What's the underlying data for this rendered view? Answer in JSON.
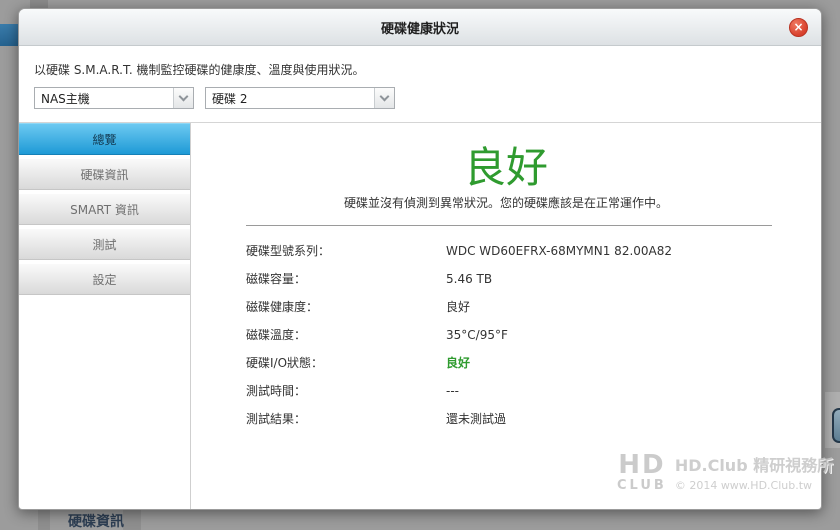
{
  "dialog": {
    "title": "硬碟健康狀況",
    "close_glyph": "×",
    "description": "以硬碟 S.M.A.R.T. 機制監控硬碟的健康度、溫度與使用狀況。",
    "selectors": {
      "host": {
        "value": "NAS主機"
      },
      "disk": {
        "value": "硬碟 2"
      }
    },
    "tabs": [
      {
        "label": "總覽",
        "active": true
      },
      {
        "label": "硬碟資訊",
        "active": false
      },
      {
        "label": "SMART 資訊",
        "active": false
      },
      {
        "label": "測試",
        "active": false
      },
      {
        "label": "設定",
        "active": false
      }
    ],
    "overview": {
      "status": "良好",
      "message": "硬碟並沒有偵測到異常狀況。您的硬碟應該是在正常運作中。",
      "details": [
        {
          "label": "硬碟型號系列：",
          "value": "WDC WD60EFRX-68MYMN1 82.00A82"
        },
        {
          "label": "磁碟容量：",
          "value": "5.46 TB"
        },
        {
          "label": "磁碟健康度：",
          "value": "良好"
        },
        {
          "label": "磁碟溫度：",
          "value": "35°C/95°F"
        },
        {
          "label": "硬碟I/O狀態：",
          "value": "良好"
        },
        {
          "label": "測試時間：",
          "value": "---"
        },
        {
          "label": "測試結果：",
          "value": "還未測試過"
        }
      ]
    }
  },
  "background": {
    "partial_tab_text": "硬碟資訊"
  },
  "watermark": {
    "logo_line1": "HD",
    "logo_line2": "CLUB",
    "line1": "HD.Club 精研視務所",
    "line2": "© 2014  www.HD.Club.tw"
  },
  "colors": {
    "status_good": "#2f9b2f",
    "active_tab_top": "#6cc9f1",
    "active_tab_bottom": "#1e9ad6",
    "close_button": "#d8402c",
    "overlay_background": "#9c9c9c",
    "background_accent_blue": "#2e6fa0"
  }
}
